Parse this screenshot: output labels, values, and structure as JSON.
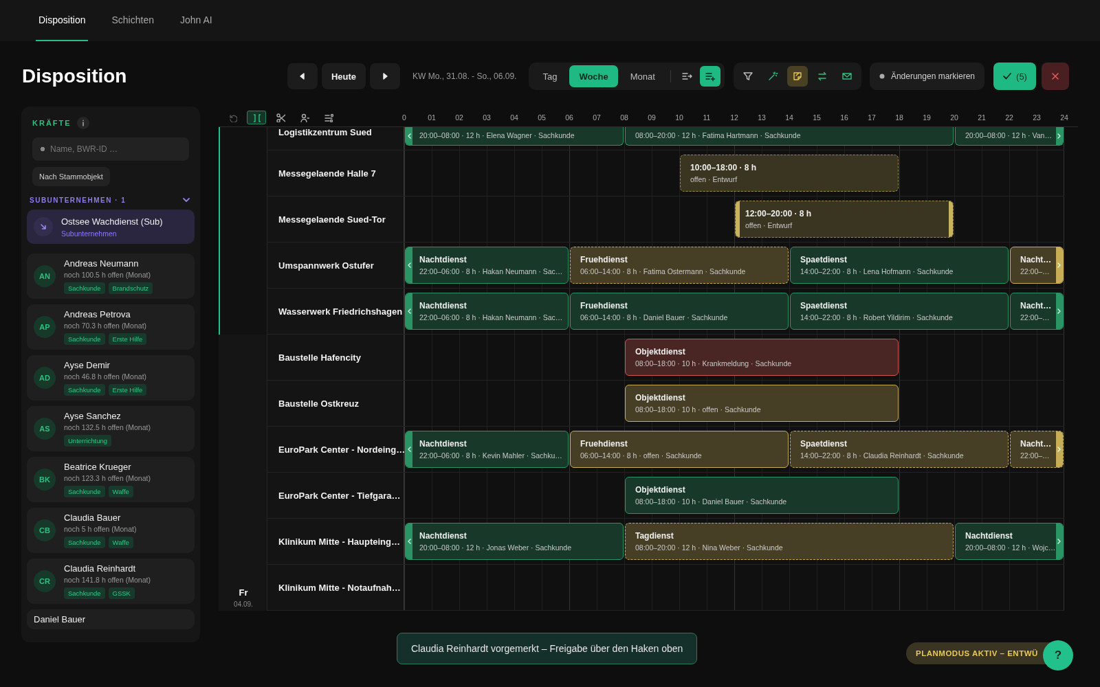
{
  "tabs": [
    {
      "label": "Disposition",
      "selected": true
    },
    {
      "label": "Schichten",
      "selected": false
    },
    {
      "label": "John AI",
      "selected": false
    }
  ],
  "page_title": "Disposition",
  "toolbar": {
    "today_button": "Heute",
    "week_range": "KW Mo., 31.08. - So., 06.09.",
    "views": [
      {
        "label": "Tag",
        "selected": false
      },
      {
        "label": "Woche",
        "selected": true
      },
      {
        "label": "Monat",
        "selected": false
      }
    ],
    "view_tools": [
      {
        "active": false
      },
      {
        "active": true
      }
    ],
    "tools": [
      {
        "active": false
      },
      {
        "active": false
      },
      {
        "active": true
      },
      {
        "active": false
      },
      {
        "active": false
      }
    ],
    "mark_changes": "Änderungen markieren",
    "confirm_button": "(5)"
  },
  "sidebar": {
    "heading": "KRÄFTE",
    "search": {
      "placeholder": "Name, BWR-ID …"
    },
    "filter_chip": "Nach Stammobjekt",
    "section": {
      "title": "SUBUNTERNEHMEN · 1",
      "expanded": true
    },
    "subcontractors": [
      {
        "name": "Ostsee Wachdienst (Sub)",
        "type": "Subunternehmen"
      }
    ],
    "staff": [
      {
        "initials": "AN",
        "name": "Andreas Neumann",
        "hours": "noch 100.5 h offen (Monat)",
        "tags": [
          "Sachkunde",
          "Brandschutz"
        ]
      },
      {
        "initials": "AP",
        "name": "Andreas Petrova",
        "hours": "noch 70.3 h offen (Monat)",
        "tags": [
          "Sachkunde",
          "Erste Hilfe"
        ]
      },
      {
        "initials": "AD",
        "name": "Ayse Demir",
        "hours": "noch 46.8 h offen (Monat)",
        "tags": [
          "Sachkunde",
          "Erste Hilfe"
        ]
      },
      {
        "initials": "AS",
        "name": "Ayse Sanchez",
        "hours": "noch 132.5 h offen (Monat)",
        "tags": [
          "Unterrichtung"
        ]
      },
      {
        "initials": "BK",
        "name": "Beatrice Krueger",
        "hours": "noch 123.3 h offen (Monat)",
        "tags": [
          "Sachkunde",
          "Waffe"
        ]
      },
      {
        "initials": "CB",
        "name": "Claudia Bauer",
        "hours": "noch 5 h offen (Monat)",
        "tags": [
          "Sachkunde",
          "Waffe"
        ]
      },
      {
        "initials": "CR",
        "name": "Claudia Reinhardt",
        "hours": "noch 141.8 h offen (Monat)",
        "tags": [
          "Sachkunde",
          "GSSK"
        ]
      },
      {
        "name": "Daniel Bauer"
      }
    ]
  },
  "schedule": {
    "grid_tools": [
      {
        "active": false,
        "disabled": true
      },
      {
        "active": true,
        "disabled": false
      },
      {
        "active": false,
        "disabled": false
      },
      {
        "active": false,
        "disabled": false
      },
      {
        "active": false,
        "disabled": false
      }
    ],
    "hours": [
      "0",
      "01",
      "02",
      "03",
      "04",
      "05",
      "06",
      "07",
      "08",
      "09",
      "10",
      "11",
      "12",
      "13",
      "14",
      "15",
      "16",
      "17",
      "18",
      "19",
      "20",
      "21",
      "22",
      "23",
      "24"
    ],
    "days": [
      {
        "selected": true,
        "rows": [
          {
            "object": "Logistikzentrum Sued",
            "cut_top": true,
            "shifts": [
              {
                "kind": "longnight",
                "color": "#2b9464",
                "draft": false,
                "selected": false,
                "cut_left": true,
                "cut_right": false,
                "detail": "20:00–08:00 · 12 h · Elena Wagner · Sachkunde"
              },
              {
                "kind": "day",
                "color": "#2b9464",
                "draft": false,
                "selected": false,
                "cut_left": false,
                "cut_right": false,
                "detail": "08:00–20:00 · 12 h · Fatima Hartmann · Sachkunde"
              },
              {
                "kind": "longnight",
                "color": "#2b9464",
                "draft": false,
                "selected": false,
                "cut_left": false,
                "cut_right": true,
                "detail": "20:00–08:00 · 12 h · Van…"
              }
            ]
          },
          {
            "object": "Messegelaende Halle 7",
            "cut_top": false,
            "shifts": [
              {
                "kind": "midday",
                "color": "#9b8a4a",
                "draft": true,
                "selected": false,
                "cut_left": false,
                "cut_right": false,
                "title": "10:00–18:00 · 8 h",
                "detail": "offen · Entwurf"
              }
            ]
          },
          {
            "object": "Messegelaende Sued-Tor",
            "cut_top": false,
            "shifts": [
              {
                "kind": "afternoon",
                "color": "#9b8a4a",
                "draft": true,
                "selected": true,
                "cut_left": false,
                "cut_right": false,
                "title": "12:00–20:00 · 8 h",
                "detail": "offen · Entwurf"
              }
            ]
          },
          {
            "object": "Umspannwerk Ostufer",
            "cut_top": false,
            "shifts": [
              {
                "kind": "night",
                "color": "#2b9464",
                "draft": false,
                "selected": false,
                "cut_left": true,
                "cut_right": false,
                "title": "Nachtdienst",
                "detail": "22:00–06:00 · 8 h · Hakan Neumann · Sac…"
              },
              {
                "kind": "early",
                "color": "#c7ad55",
                "draft": true,
                "selected": false,
                "cut_left": false,
                "cut_right": false,
                "title": "Fruehdienst",
                "detail": "06:00–14:00 · 8 h · Fatima Ostermann · Sachkunde"
              },
              {
                "kind": "late",
                "color": "#2b9464",
                "draft": false,
                "selected": false,
                "cut_left": false,
                "cut_right": false,
                "title": "Spaetdienst",
                "detail": "14:00–22:00 · 8 h · Lena Hofmann · Sachkunde"
              },
              {
                "kind": "night",
                "color": "#c7ad55",
                "draft": false,
                "selected": false,
                "cut_left": false,
                "cut_right": true,
                "title": "Nacht…",
                "detail": "22:00–…"
              }
            ]
          },
          {
            "object": "Wasserwerk Friedrichshagen",
            "cut_top": false,
            "shifts": [
              {
                "kind": "night",
                "color": "#2b9464",
                "draft": false,
                "selected": false,
                "cut_left": true,
                "cut_right": false,
                "title": "Nachtdienst",
                "detail": "22:00–06:00 · 8 h · Hakan Neumann · Sac…"
              },
              {
                "kind": "early",
                "color": "#2b9464",
                "draft": false,
                "selected": false,
                "cut_left": false,
                "cut_right": false,
                "title": "Fruehdienst",
                "detail": "06:00–14:00 · 8 h · Daniel Bauer · Sachkunde"
              },
              {
                "kind": "late",
                "color": "#2b9464",
                "draft": false,
                "selected": false,
                "cut_left": false,
                "cut_right": false,
                "title": "Spaetdienst",
                "detail": "14:00–22:00 · 8 h · Robert Yildirim · Sachkunde"
              },
              {
                "kind": "night",
                "color": "#2b9464",
                "draft": false,
                "selected": false,
                "cut_left": false,
                "cut_right": true,
                "title": "Nacht…",
                "detail": "22:00–…"
              }
            ]
          }
        ]
      },
      {
        "label": "Fr",
        "date": "04.09.",
        "selected": false,
        "rows": [
          {
            "object": "Baustelle Hafencity",
            "cut_top": false,
            "shifts": [
              {
                "kind": "object",
                "color": "#cf5552",
                "draft": false,
                "selected": false,
                "cut_left": false,
                "cut_right": false,
                "title": "Objektdienst",
                "detail": "08:00–18:00 · 10 h · Krankmeldung · Sachkunde"
              }
            ]
          },
          {
            "object": "Baustelle Ostkreuz",
            "cut_top": false,
            "shifts": [
              {
                "kind": "object",
                "color": "#c7ad55",
                "draft": false,
                "selected": false,
                "cut_left": false,
                "cut_right": false,
                "title": "Objektdienst",
                "detail": "08:00–18:00 · 10 h · offen · Sachkunde"
              }
            ]
          },
          {
            "object": "EuroPark Center - Nordeing…",
            "cut_top": false,
            "shifts": [
              {
                "kind": "night",
                "color": "#2b9464",
                "draft": false,
                "selected": false,
                "cut_left": true,
                "cut_right": false,
                "title": "Nachtdienst",
                "detail": "22:00–06:00 · 8 h · Kevin Mahler · Sachku…"
              },
              {
                "kind": "early",
                "color": "#c7ad55",
                "draft": false,
                "selected": false,
                "cut_left": false,
                "cut_right": false,
                "title": "Fruehdienst",
                "detail": "06:00–14:00 · 8 h · offen · Sachkunde"
              },
              {
                "kind": "late",
                "color": "#c7ad55",
                "draft": true,
                "selected": false,
                "cut_left": false,
                "cut_right": false,
                "title": "Spaetdienst",
                "detail": "14:00–22:00 · 8 h · Claudia Reinhardt · Sachkunde"
              },
              {
                "kind": "night",
                "color": "#c7ad55",
                "draft": true,
                "selected": false,
                "cut_left": false,
                "cut_right": true,
                "title": "Nacht…",
                "detail": "22:00–…"
              }
            ]
          },
          {
            "object": "EuroPark Center - Tiefgara…",
            "cut_top": false,
            "shifts": [
              {
                "kind": "object",
                "color": "#2b9464",
                "draft": false,
                "selected": false,
                "cut_left": false,
                "cut_right": false,
                "title": "Objektdienst",
                "detail": "08:00–18:00 · 10 h · Daniel Bauer · Sachkunde"
              }
            ]
          },
          {
            "object": "Klinikum Mitte - Haupteing…",
            "cut_top": false,
            "shifts": [
              {
                "kind": "longnight",
                "color": "#2b9464",
                "draft": false,
                "selected": false,
                "cut_left": true,
                "cut_right": false,
                "title": "Nachtdienst",
                "detail": "20:00–08:00 · 12 h · Jonas Weber · Sachkunde"
              },
              {
                "kind": "day",
                "color": "#c7ad55",
                "draft": true,
                "selected": false,
                "cut_left": false,
                "cut_right": false,
                "title": "Tagdienst",
                "detail": "08:00–20:00 · 12 h · Nina Weber · Sachkunde"
              },
              {
                "kind": "longnight",
                "color": "#2b9464",
                "draft": false,
                "selected": false,
                "cut_left": false,
                "cut_right": true,
                "title": "Nachtdienst",
                "detail": "20:00–08:00 · 12 h · Wojc…"
              }
            ]
          },
          {
            "object": "Klinikum Mitte - Notaufnah…",
            "cut_top": false,
            "shifts": []
          }
        ]
      }
    ]
  },
  "toast": "Claudia Reinhardt vorgemerkt – Freigabe über den Haken oben",
  "mode_badge": "PLANMODUS AKTIV – ENTWÜ",
  "help_button": "?"
}
